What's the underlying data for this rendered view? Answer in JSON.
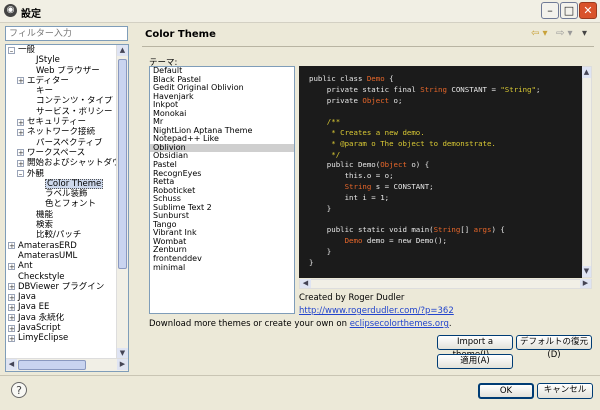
{
  "window": {
    "title": "設定",
    "minimize": "–",
    "maximize": "□",
    "close": "✕"
  },
  "filter": {
    "placeholder": "フィルター入力"
  },
  "tree": [
    {
      "label": "一般",
      "indent": 1,
      "expander": "–"
    },
    {
      "label": "JStyle",
      "indent": 3
    },
    {
      "label": "Web ブラウザー",
      "indent": 3
    },
    {
      "label": "エディター",
      "indent": 2,
      "expander": "+"
    },
    {
      "label": "キー",
      "indent": 3
    },
    {
      "label": "コンテンツ・タイプ",
      "indent": 3
    },
    {
      "label": "サービス・ポリシー",
      "indent": 3
    },
    {
      "label": "セキュリティー",
      "indent": 2,
      "expander": "+"
    },
    {
      "label": "ネットワーク接続",
      "indent": 2,
      "expander": "+"
    },
    {
      "label": "パースペクティブ",
      "indent": 3
    },
    {
      "label": "ワークスペース",
      "indent": 2,
      "expander": "+"
    },
    {
      "label": "開始およびシャットダウ",
      "indent": 2,
      "expander": "+"
    },
    {
      "label": "外観",
      "indent": 2,
      "expander": "–"
    },
    {
      "label": "Color Theme",
      "indent": 4,
      "selected": true
    },
    {
      "label": "ラベル装飾",
      "indent": 4
    },
    {
      "label": "色とフォント",
      "indent": 4
    },
    {
      "label": "機能",
      "indent": 3
    },
    {
      "label": "検索",
      "indent": 3
    },
    {
      "label": "比較/パッチ",
      "indent": 3
    },
    {
      "label": "AmaterasERD",
      "indent": 1,
      "expander": "+"
    },
    {
      "label": "AmaterasUML",
      "indent": 1
    },
    {
      "label": "Ant",
      "indent": 1,
      "expander": "+"
    },
    {
      "label": "Checkstyle",
      "indent": 1
    },
    {
      "label": "DBViewer プラグイン",
      "indent": 1,
      "expander": "+"
    },
    {
      "label": "Java",
      "indent": 1,
      "expander": "+"
    },
    {
      "label": "Java EE",
      "indent": 1,
      "expander": "+"
    },
    {
      "label": "Java 永続化",
      "indent": 1,
      "expander": "+"
    },
    {
      "label": "JavaScript",
      "indent": 1,
      "expander": "+"
    },
    {
      "label": "LimyEclipse",
      "indent": 1,
      "expander": "+"
    }
  ],
  "panel": {
    "title": "Color Theme",
    "theme_label": "テーマ:",
    "nav_back": "⇦ ▾",
    "nav_forward": "⇨ ▾",
    "nav_menu": "▾"
  },
  "themes": [
    "Default",
    "Black Pastel",
    "Gedit Original Oblivion",
    "Havenjark",
    "Inkpot",
    "Monokai",
    "Mr",
    "NightLion Aptana Theme",
    "Notepad++ Like",
    "Oblivion",
    "Obsidian",
    "Pastel",
    "RecognEyes",
    "Retta",
    "Roboticket",
    "Schuss",
    "Sublime Text 2",
    "Sunburst",
    "Tango",
    "Vibrant Ink",
    "Wombat",
    "Zenburn",
    "frontenddev",
    "minimal"
  ],
  "selected_theme": "Oblivion",
  "code_lines": [
    [
      {
        "t": "public class ",
        "c": "w"
      },
      {
        "t": "Demo",
        "c": "o"
      },
      {
        "t": " {",
        "c": "w"
      }
    ],
    [
      {
        "t": "    private static final ",
        "c": "w"
      },
      {
        "t": "String",
        "c": "o"
      },
      {
        "t": " CONSTANT = ",
        "c": "w"
      },
      {
        "t": "\"String\"",
        "c": "y"
      },
      {
        "t": ";",
        "c": "w"
      }
    ],
    [
      {
        "t": "    private ",
        "c": "w"
      },
      {
        "t": "Object",
        "c": "o"
      },
      {
        "t": " o;",
        "c": "w"
      }
    ],
    [],
    [
      {
        "t": "    /**",
        "c": "y"
      }
    ],
    [
      {
        "t": "     * Creates a new demo.",
        "c": "y"
      }
    ],
    [
      {
        "t": "     * @param o The object to demonstrate.",
        "c": "y"
      }
    ],
    [
      {
        "t": "     */",
        "c": "y"
      }
    ],
    [
      {
        "t": "    public Demo(",
        "c": "w"
      },
      {
        "t": "Object",
        "c": "o"
      },
      {
        "t": " o) {",
        "c": "w"
      }
    ],
    [
      {
        "t": "        this.o = o;",
        "c": "w"
      }
    ],
    [
      {
        "t": "        ",
        "c": "w"
      },
      {
        "t": "String",
        "c": "o"
      },
      {
        "t": " s = CONSTANT;",
        "c": "w"
      }
    ],
    [
      {
        "t": "        int i = 1;",
        "c": "w"
      }
    ],
    [
      {
        "t": "    }",
        "c": "w"
      }
    ],
    [],
    [
      {
        "t": "    public static void main(",
        "c": "w"
      },
      {
        "t": "String",
        "c": "o"
      },
      {
        "t": "[] ",
        "c": "w"
      },
      {
        "t": "args",
        "c": "o"
      },
      {
        "t": ") {",
        "c": "w"
      }
    ],
    [
      {
        "t": "        ",
        "c": "w"
      },
      {
        "t": "Demo",
        "c": "o"
      },
      {
        "t": " demo = new Demo();",
        "c": "w"
      }
    ],
    [
      {
        "t": "    }",
        "c": "w"
      }
    ],
    [
      {
        "t": "}",
        "c": "w"
      }
    ]
  ],
  "code_colors": {
    "bg": "#1b1b1b",
    "w": "#e8e8e8",
    "o": "#e8672a",
    "y": "#d9c934"
  },
  "author": {
    "created_by": "Created by Roger Dudler",
    "url": "http://www.rogerdudler.com/?p=362"
  },
  "download": {
    "text_before": "Download more themes or create your own on ",
    "link": "eclipsecolorthemes.org",
    "text_after": "."
  },
  "buttons": {
    "import": "Import a theme(I)...",
    "restore": "デフォルトの復元(D)",
    "apply": "適用(A)",
    "ok": "OK",
    "cancel": "キャンセル"
  },
  "help": "?"
}
